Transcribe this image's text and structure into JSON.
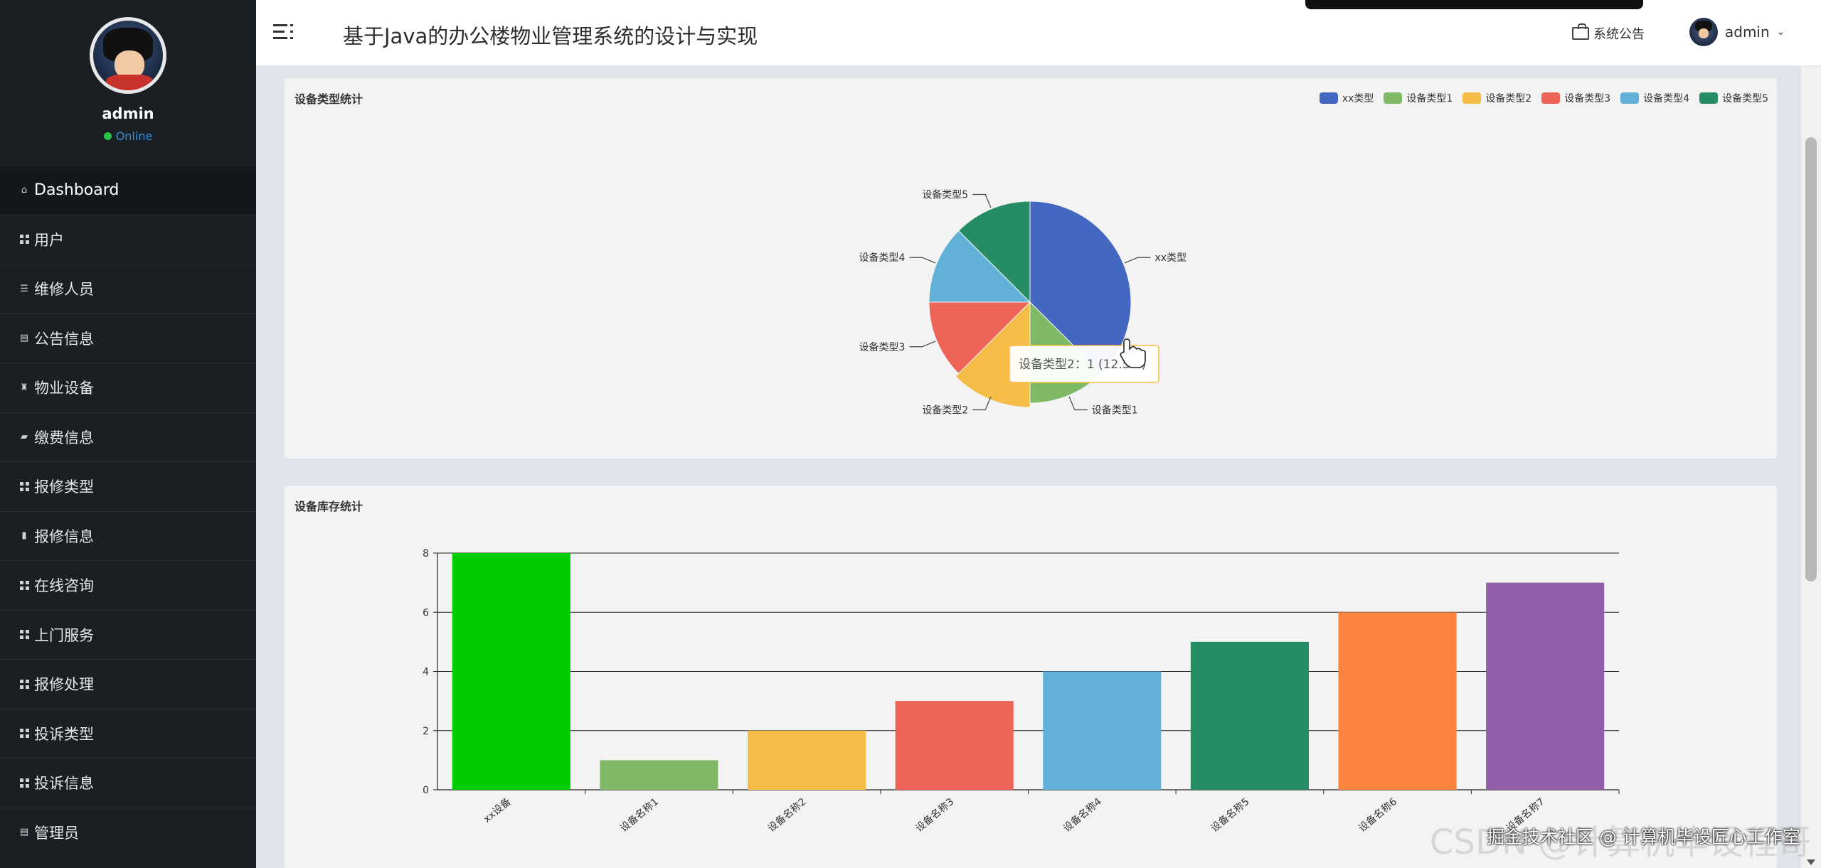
{
  "header": {
    "title": "基于Java的办公楼物业管理系统的设计与实现",
    "notice_label": "系统公告",
    "user_name": "admin"
  },
  "sidebar": {
    "profile_name": "admin",
    "profile_status": "Online",
    "items": [
      {
        "label": "Dashboard",
        "icon": "home-icon"
      },
      {
        "label": "用户",
        "icon": "grid-icon"
      },
      {
        "label": "维修人员",
        "icon": "sliders-icon"
      },
      {
        "label": "公告信息",
        "icon": "clipboard-icon"
      },
      {
        "label": "物业设备",
        "icon": "trophy-icon"
      },
      {
        "label": "缴费信息",
        "icon": "wallet-icon"
      },
      {
        "label": "报修类型",
        "icon": "grid-icon"
      },
      {
        "label": "报修信息",
        "icon": "bar-chart-icon"
      },
      {
        "label": "在线咨询",
        "icon": "grid-icon"
      },
      {
        "label": "上门服务",
        "icon": "grid-icon"
      },
      {
        "label": "报修处理",
        "icon": "grid-icon"
      },
      {
        "label": "投诉类型",
        "icon": "grid-icon"
      },
      {
        "label": "投诉信息",
        "icon": "grid-icon"
      },
      {
        "label": "管理员",
        "icon": "document-icon"
      }
    ]
  },
  "pie_card": {
    "title": "设备类型统计",
    "tooltip": "设备类型2：1 (12.5%)"
  },
  "bar_card": {
    "title": "设备库存统计"
  },
  "watermark": {
    "line1": "CSDN @计算机毕设程哥",
    "line2": "掘金技术社区 @ 计算机毕设匠心工作室"
  },
  "colors": {
    "sidebar_bg": "#1a1f24",
    "online": "#2ac34b",
    "card_bg": "#f3f3f3"
  },
  "chart_data": [
    {
      "type": "pie",
      "title": "设备类型统计",
      "categories": [
        "xx类型",
        "设备类型1",
        "设备类型2",
        "设备类型3",
        "设备类型4",
        "设备类型5"
      ],
      "values": [
        3,
        1,
        1,
        1,
        1,
        1
      ],
      "colors": [
        "#4468c1",
        "#7fb966",
        "#f5bd47",
        "#ed6456",
        "#60b0d8",
        "#258c63"
      ],
      "legend": "top-right"
    },
    {
      "type": "bar",
      "title": "设备库存统计",
      "categories": [
        "xx设备",
        "设备名称1",
        "设备名称2",
        "设备名称3",
        "设备名称4",
        "设备名称5",
        "设备名称6",
        "设备名称7"
      ],
      "values": [
        8,
        1,
        2,
        3,
        4,
        5,
        6,
        7
      ],
      "colors": [
        "#00cc00",
        "#7fb966",
        "#f5bd47",
        "#ed6456",
        "#60b0d8",
        "#258c63",
        "#fc843f",
        "#915ea9"
      ],
      "yticks": [
        "0",
        "2",
        "4",
        "6",
        "8"
      ],
      "ylim": [
        0,
        8
      ],
      "grid": true
    }
  ]
}
